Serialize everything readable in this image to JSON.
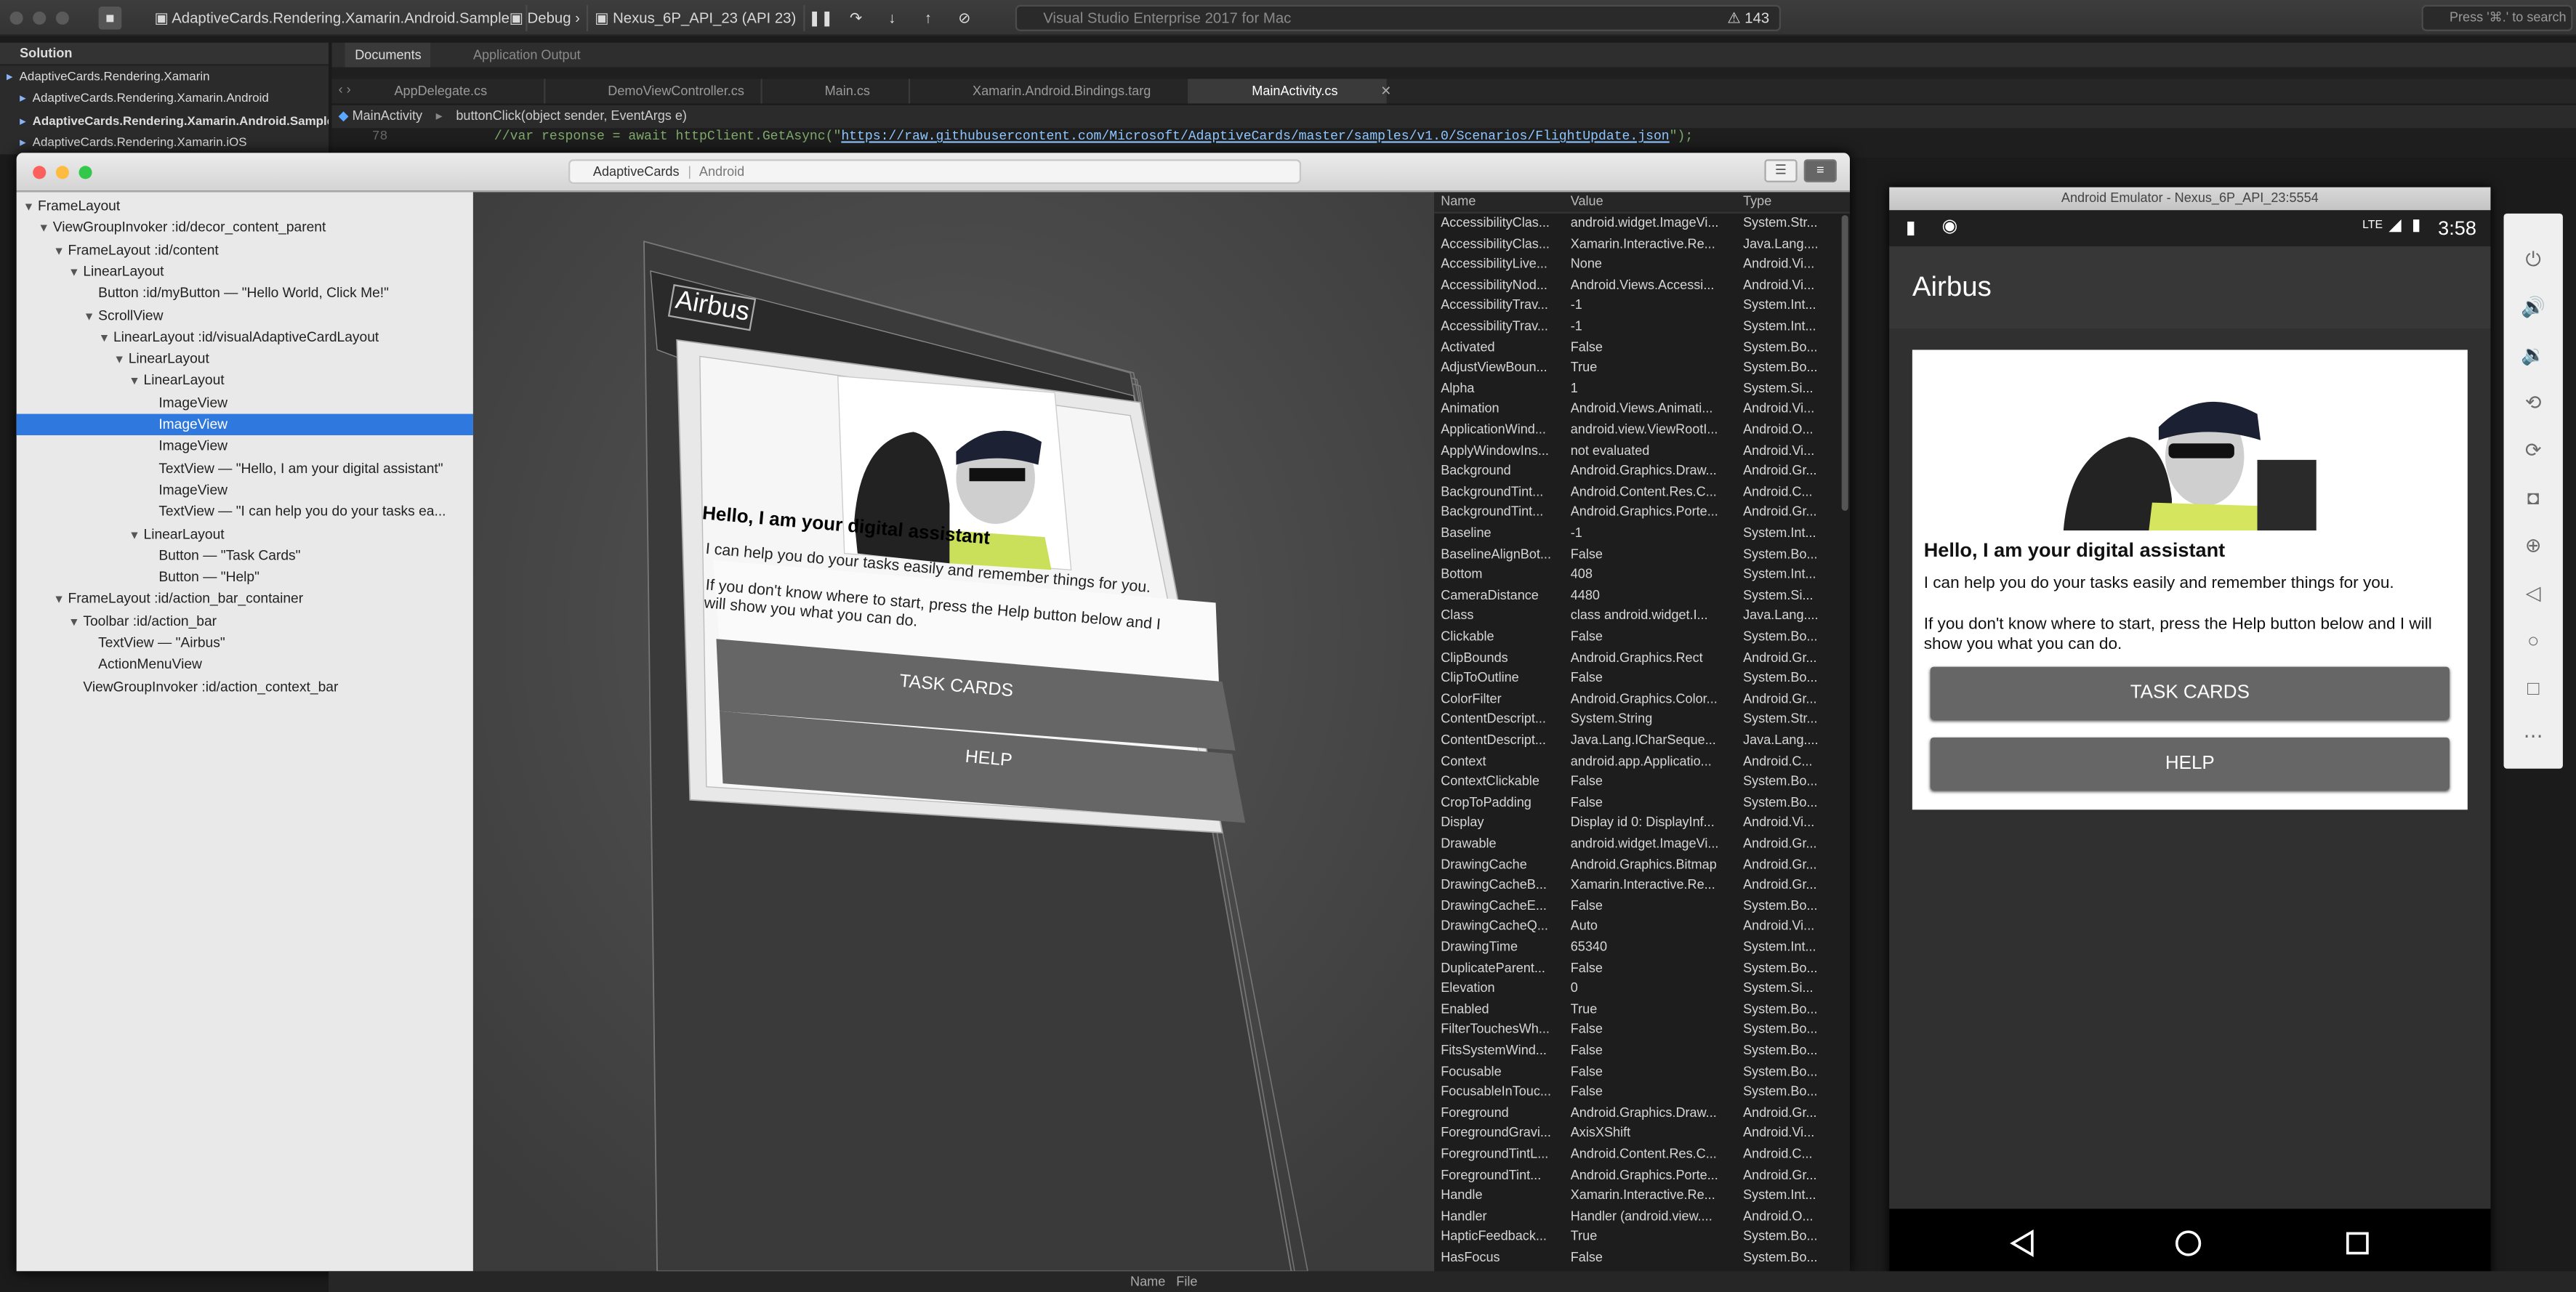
{
  "ide": {
    "project_selector": "AdaptiveCards.Rendering.Xamarin.Android.Sample",
    "config_selector": "Debug",
    "device_selector": "Nexus_6P_API_23 (API 23)",
    "status_text": "Visual Studio Enterprise 2017 for Mac",
    "warning_count": "143",
    "search_placeholder": "Press '⌘.' to search",
    "solution": {
      "title": "Solution",
      "items": [
        "AdaptiveCards.Rendering.Xamarin",
        "AdaptiveCards.Rendering.Xamarin.Android",
        "AdaptiveCards.Rendering.Xamarin.Android.Sample",
        "AdaptiveCards.Rendering.Xamarin.iOS"
      ]
    },
    "pad_tabs": [
      "Documents",
      "Application Output"
    ],
    "file_tabs": [
      "AppDelegate.cs",
      "DemoViewController.cs",
      "Main.cs",
      "Xamarin.Android.Bindings.targ",
      "MainActivity.cs"
    ],
    "breadcrumb": {
      "class": "MainActivity",
      "method": "buttonClick(object sender, EventArgs e)"
    },
    "code_line_number": "78",
    "code_prefix": "//var response = await httpClient.GetAsync(\"",
    "code_url": "https://raw.githubusercontent.com/Microsoft/AdaptiveCards/master/samples/v1.0/Scenarios/FlightUpdate.json",
    "code_suffix": "\");",
    "bottom_cols": [
      "Name",
      "File"
    ]
  },
  "inspector": {
    "url_left": "AdaptiveCards",
    "url_right": "Android",
    "tree": [
      {
        "label": "FrameLayout",
        "depth": 0,
        "selected": false
      },
      {
        "label": "ViewGroupInvoker :id/decor_content_parent",
        "depth": 1,
        "selected": false
      },
      {
        "label": "FrameLayout :id/content",
        "depth": 2,
        "selected": false
      },
      {
        "label": "LinearLayout",
        "depth": 3,
        "selected": false
      },
      {
        "label": "Button :id/myButton — \"Hello World, Click Me!\"",
        "depth": 4,
        "selected": false,
        "leaf": true
      },
      {
        "label": "ScrollView",
        "depth": 4,
        "selected": false
      },
      {
        "label": "LinearLayout :id/visualAdaptiveCardLayout",
        "depth": 5,
        "selected": false
      },
      {
        "label": "LinearLayout",
        "depth": 6,
        "selected": false
      },
      {
        "label": "LinearLayout",
        "depth": 7,
        "selected": false
      },
      {
        "label": "ImageView",
        "depth": 8,
        "selected": false,
        "leaf": true
      },
      {
        "label": "ImageView",
        "depth": 8,
        "selected": true,
        "leaf": true
      },
      {
        "label": "ImageView",
        "depth": 8,
        "selected": false,
        "leaf": true
      },
      {
        "label": "TextView — \"Hello, I am your digital assistant\"",
        "depth": 8,
        "selected": false,
        "leaf": true
      },
      {
        "label": "ImageView",
        "depth": 8,
        "selected": false,
        "leaf": true
      },
      {
        "label": "TextView — \"I can help you do your tasks ea...",
        "depth": 8,
        "selected": false,
        "leaf": true
      },
      {
        "label": "LinearLayout",
        "depth": 7,
        "selected": false
      },
      {
        "label": "Button — \"Task Cards\"",
        "depth": 8,
        "selected": false,
        "leaf": true
      },
      {
        "label": "Button — \"Help\"",
        "depth": 8,
        "selected": false,
        "leaf": true
      },
      {
        "label": "FrameLayout :id/action_bar_container",
        "depth": 2,
        "selected": false
      },
      {
        "label": "Toolbar :id/action_bar",
        "depth": 3,
        "selected": false
      },
      {
        "label": "TextView — \"Airbus\"",
        "depth": 4,
        "selected": false,
        "leaf": true
      },
      {
        "label": "ActionMenuView",
        "depth": 4,
        "selected": false,
        "leaf": true
      },
      {
        "label": "ViewGroupInvoker :id/action_context_bar",
        "depth": 3,
        "selected": false,
        "leaf": true
      }
    ],
    "viewport": {
      "title": "Airbus",
      "heading": "Hello, I am your digital assistant",
      "line1": "I can help you do your tasks easily and remember things for you.",
      "line2": "If you don't know where to start, press the Help button below and I will show you what you can do.",
      "btn1": "TASK CARDS",
      "btn2": "HELP"
    },
    "props_headers": [
      "Name",
      "Value",
      "Type"
    ],
    "props": [
      [
        "AccessibilityClas...",
        "android.widget.ImageVi...",
        "System.Str..."
      ],
      [
        "AccessibilityClas...",
        "Xamarin.Interactive.Re...",
        "Java.Lang...."
      ],
      [
        "AccessibilityLive...",
        "None",
        "Android.Vi..."
      ],
      [
        "AccessibilityNod...",
        "Android.Views.Accessi...",
        "Android.Vi..."
      ],
      [
        "AccessibilityTrav...",
        "-1",
        "System.Int..."
      ],
      [
        "AccessibilityTrav...",
        "-1",
        "System.Int..."
      ],
      [
        "Activated",
        "False",
        "System.Bo..."
      ],
      [
        "AdjustViewBoun...",
        "True",
        "System.Bo..."
      ],
      [
        "Alpha",
        "1",
        "System.Si..."
      ],
      [
        "Animation",
        "Android.Views.Animati...",
        "Android.Vi..."
      ],
      [
        "ApplicationWind...",
        "android.view.ViewRootI...",
        "Android.O..."
      ],
      [
        "ApplyWindowIns...",
        "not evaluated",
        "Android.Vi..."
      ],
      [
        "Background",
        "Android.Graphics.Draw...",
        "Android.Gr..."
      ],
      [
        "BackgroundTint...",
        "Android.Content.Res.C...",
        "Android.C..."
      ],
      [
        "BackgroundTint...",
        "Android.Graphics.Porte...",
        "Android.Gr..."
      ],
      [
        "Baseline",
        "-1",
        "System.Int..."
      ],
      [
        "BaselineAlignBot...",
        "False",
        "System.Bo..."
      ],
      [
        "Bottom",
        "408",
        "System.Int..."
      ],
      [
        "CameraDistance",
        "4480",
        "System.Si..."
      ],
      [
        "Class",
        "class android.widget.I...",
        "Java.Lang...."
      ],
      [
        "Clickable",
        "False",
        "System.Bo..."
      ],
      [
        "ClipBounds",
        "Android.Graphics.Rect",
        "Android.Gr..."
      ],
      [
        "ClipToOutline",
        "False",
        "System.Bo..."
      ],
      [
        "ColorFilter",
        "Android.Graphics.Color...",
        "Android.Gr..."
      ],
      [
        "ContentDescript...",
        "System.String",
        "System.Str..."
      ],
      [
        "ContentDescript...",
        "Java.Lang.ICharSeque...",
        "Java.Lang...."
      ],
      [
        "Context",
        "android.app.Applicatio...",
        "Android.C..."
      ],
      [
        "ContextClickable",
        "False",
        "System.Bo..."
      ],
      [
        "CropToPadding",
        "False",
        "System.Bo..."
      ],
      [
        "Display",
        "Display id 0: DisplayInf...",
        "Android.Vi..."
      ],
      [
        "Drawable",
        "android.widget.ImageVi...",
        "Android.Gr..."
      ],
      [
        "DrawingCache",
        "Android.Graphics.Bitmap",
        "Android.Gr..."
      ],
      [
        "DrawingCacheB...",
        "Xamarin.Interactive.Re...",
        "Android.Gr..."
      ],
      [
        "DrawingCacheE...",
        "False",
        "System.Bo..."
      ],
      [
        "DrawingCacheQ...",
        "Auto",
        "Android.Vi..."
      ],
      [
        "DrawingTime",
        "65340",
        "System.Int..."
      ],
      [
        "DuplicateParent...",
        "False",
        "System.Bo..."
      ],
      [
        "Elevation",
        "0",
        "System.Si..."
      ],
      [
        "Enabled",
        "True",
        "System.Bo..."
      ],
      [
        "FilterTouchesWh...",
        "False",
        "System.Bo..."
      ],
      [
        "FitsSystemWind...",
        "False",
        "System.Bo..."
      ],
      [
        "Focusable",
        "False",
        "System.Bo..."
      ],
      [
        "FocusableInTouc...",
        "False",
        "System.Bo..."
      ],
      [
        "Foreground",
        "Android.Graphics.Draw...",
        "Android.Gr..."
      ],
      [
        "ForegroundGravi...",
        "AxisXShift",
        "Android.Vi..."
      ],
      [
        "ForegroundTintL...",
        "Android.Content.Res.C...",
        "Android.C..."
      ],
      [
        "ForegroundTint...",
        "Android.Graphics.Porte...",
        "Android.Gr..."
      ],
      [
        "Handle",
        "Xamarin.Interactive.Re...",
        "System.Int..."
      ],
      [
        "Handler",
        "Handler (android.view....",
        "Android.O..."
      ],
      [
        "HapticFeedback...",
        "True",
        "System.Bo..."
      ],
      [
        "HasFocus",
        "False",
        "System.Bo..."
      ]
    ]
  },
  "emulator": {
    "title": "Android Emulator - Nexus_6P_API_23:5554",
    "network": "LTE",
    "time": "3:58",
    "app_title": "Airbus",
    "heading": "Hello, I am your digital assistant",
    "line1": "I can help you do your tasks easily and remember things for you.",
    "line2": "If you don't know where to start, press the Help button below and I will show you what you can do.",
    "btn1": "TASK CARDS",
    "btn2": "HELP"
  },
  "colors": {
    "selection": "#2f79de",
    "link": "#8ec6ff"
  }
}
